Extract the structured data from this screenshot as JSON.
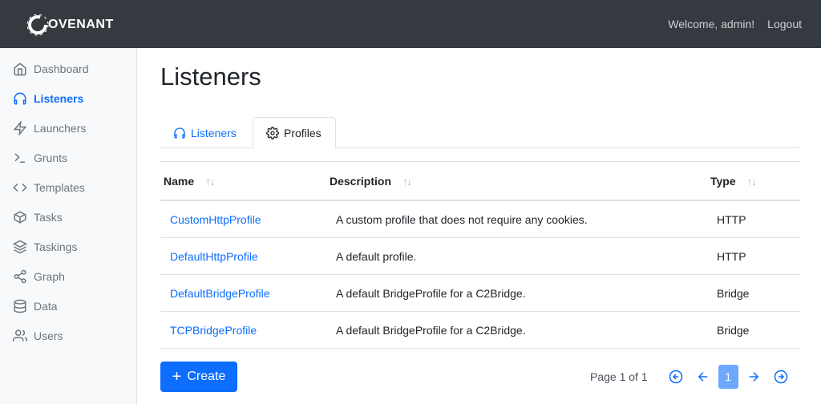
{
  "header": {
    "brand": "OVENANT",
    "welcome": "Welcome, admin!",
    "logout": "Logout"
  },
  "sidebar": {
    "items": [
      {
        "label": "Dashboard",
        "icon": "home-icon",
        "active": false
      },
      {
        "label": "Listeners",
        "icon": "headphones-icon",
        "active": true
      },
      {
        "label": "Launchers",
        "icon": "lightning-icon",
        "active": false
      },
      {
        "label": "Grunts",
        "icon": "terminal-icon",
        "active": false
      },
      {
        "label": "Templates",
        "icon": "code-icon",
        "active": false
      },
      {
        "label": "Tasks",
        "icon": "box-icon",
        "active": false
      },
      {
        "label": "Taskings",
        "icon": "layers-icon",
        "active": false
      },
      {
        "label": "Graph",
        "icon": "share-icon",
        "active": false
      },
      {
        "label": "Data",
        "icon": "database-icon",
        "active": false
      },
      {
        "label": "Users",
        "icon": "users-icon",
        "active": false
      }
    ]
  },
  "main": {
    "title": "Listeners",
    "tabs": [
      {
        "label": "Listeners",
        "icon": "headphones-icon",
        "active": false
      },
      {
        "label": "Profiles",
        "icon": "gear-icon",
        "active": true
      }
    ],
    "table": {
      "columns": [
        "Name",
        "Description",
        "Type"
      ],
      "sort_glyph": "↑↓",
      "rows": [
        [
          "CustomHttpProfile",
          "A custom profile that does not require any cookies.",
          "HTTP"
        ],
        [
          "DefaultHttpProfile",
          "A default profile.",
          "HTTP"
        ],
        [
          "DefaultBridgeProfile",
          "A default BridgeProfile for a C2Bridge.",
          "Bridge"
        ],
        [
          "TCPBridgeProfile",
          "A default BridgeProfile for a C2Bridge.",
          "Bridge"
        ]
      ]
    },
    "create_label": "Create",
    "pagination": {
      "info": "Page 1 of 1",
      "current": "1"
    }
  },
  "colors": {
    "accent": "#0d6efd",
    "topbar": "#343a40",
    "sidebar_bg": "#f8f9fa"
  }
}
